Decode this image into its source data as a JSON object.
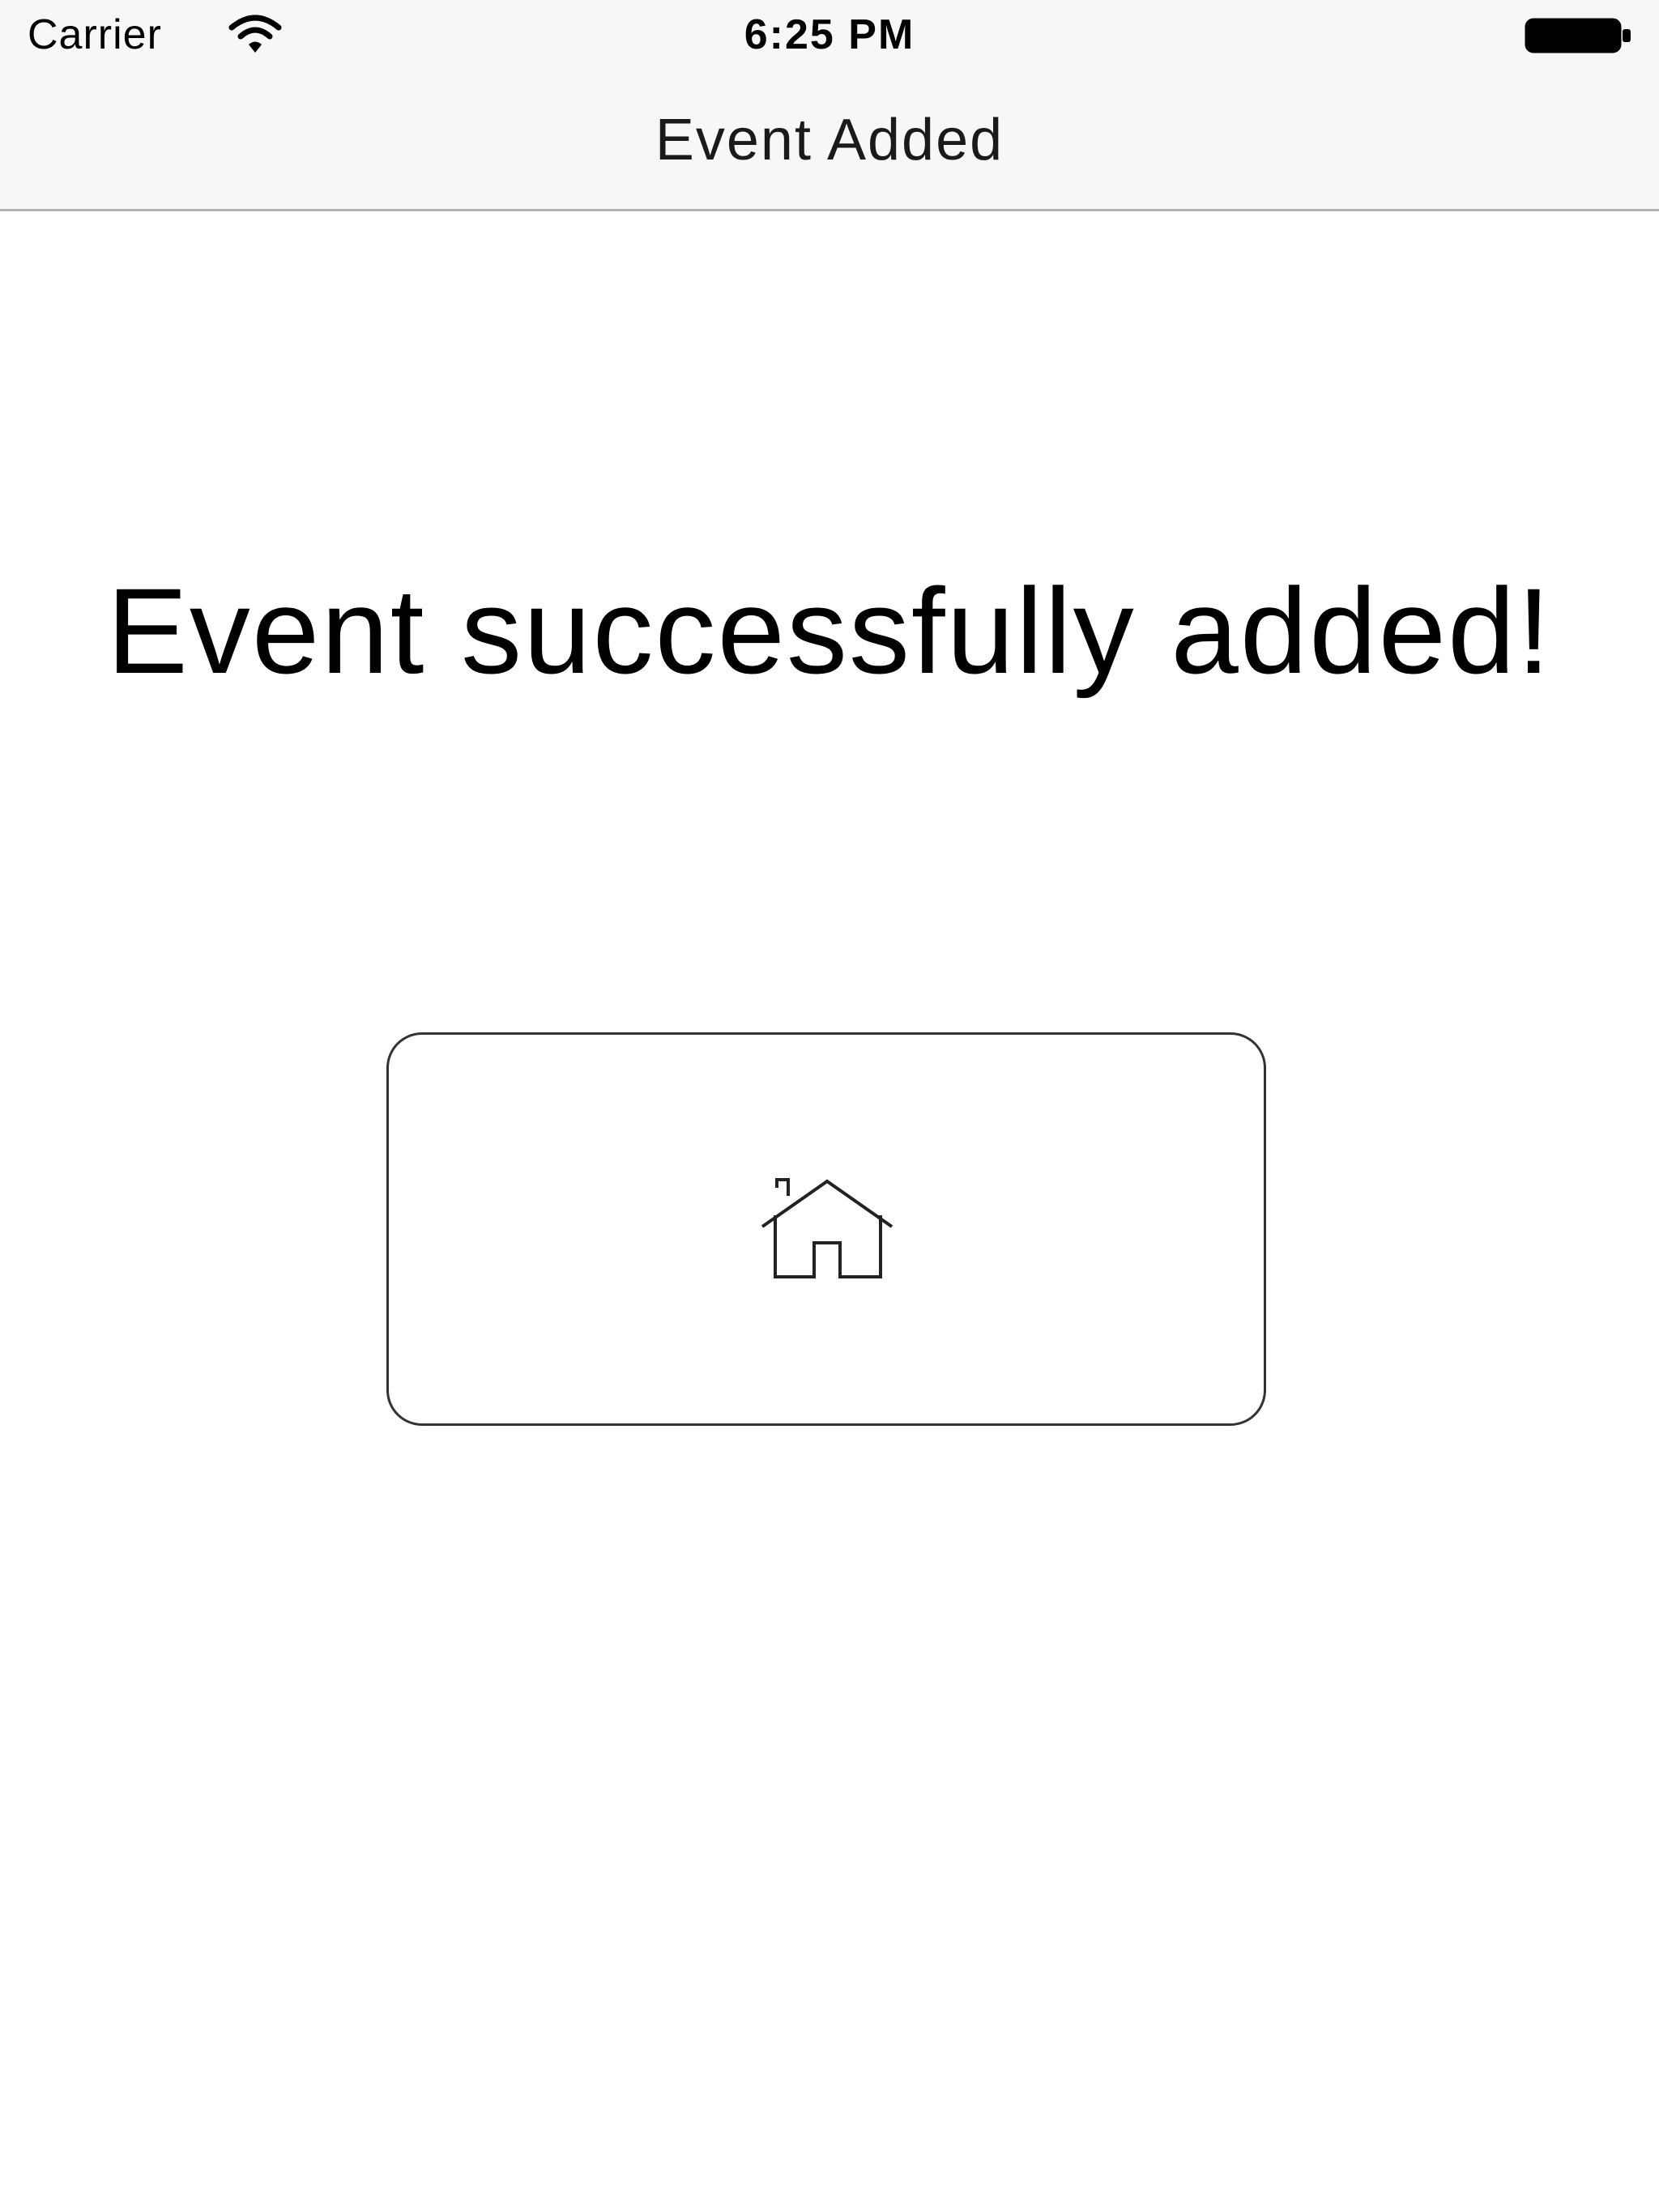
{
  "status_bar": {
    "carrier": "Carrier",
    "time": "6:25 PM",
    "wifi_icon": "wifi-icon",
    "battery_icon": "battery-full-icon"
  },
  "nav_bar": {
    "title": "Event Added"
  },
  "main": {
    "message": "Event successfully added!",
    "home_button": {
      "icon": "home-icon"
    }
  },
  "colors": {
    "nav_background": "#f7f7f7",
    "nav_border": "#b2b2b2",
    "button_border": "#333333",
    "text": "#000000"
  }
}
